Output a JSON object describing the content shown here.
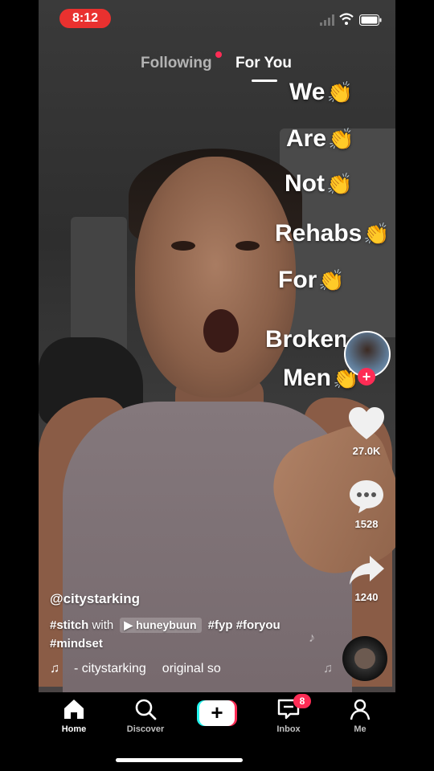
{
  "status_bar": {
    "time": "8:12"
  },
  "top_tabs": {
    "following": "Following",
    "for_you": "For You"
  },
  "overlay_words": [
    "We",
    "Are",
    "Not",
    "Rehabs",
    "For",
    "Broken",
    "Men"
  ],
  "actions": {
    "likes": "27.0K",
    "comments": "1528",
    "shares": "1240"
  },
  "caption": {
    "username": "@citystarking",
    "line1_tag1": "#stitch",
    "line1_with": "with",
    "line1_chip": "huneybuun",
    "line1_tag2": "#fyp",
    "line1_tag3": "#foryou",
    "line2_tag": "#mindset"
  },
  "music": {
    "credit": "- citystarking",
    "sound": "original so"
  },
  "nav": {
    "home": "Home",
    "discover": "Discover",
    "create": "+",
    "inbox": "Inbox",
    "inbox_badge": "8",
    "me": "Me"
  },
  "colors": {
    "accent": "#fe2c55",
    "cyan": "#25f4ee",
    "time_pill": "#e9312f"
  },
  "icons": {
    "home": "home-icon",
    "discover": "search-icon",
    "inbox": "inbox-icon",
    "me": "person-icon",
    "like": "heart-icon",
    "comment": "comment-icon",
    "share": "share-icon",
    "music": "music-note-icon"
  }
}
